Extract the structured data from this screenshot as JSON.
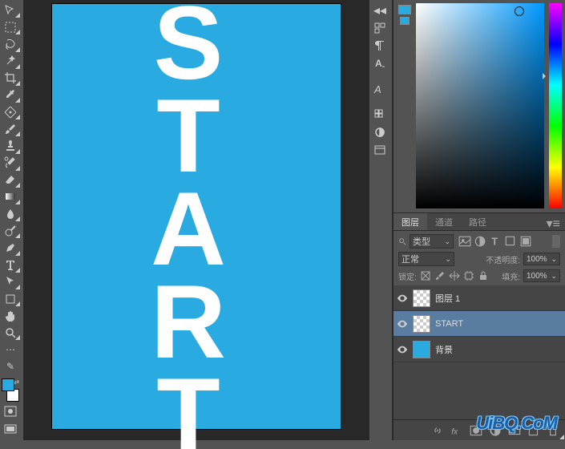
{
  "canvas": {
    "text": "START",
    "bg_color": "#29abe2",
    "text_color": "#ffffff"
  },
  "colors": {
    "foreground": "#29abe2",
    "background": "#ffffff"
  },
  "layers_panel": {
    "tabs": [
      "图层",
      "通道",
      "路径"
    ],
    "active_tab": 0,
    "filter_type": "类型",
    "blend_mode": "正常",
    "opacity_label": "不透明度:",
    "opacity_value": "100%",
    "lock_label": "锁定:",
    "fill_label": "填充:",
    "fill_value": "100%",
    "layers": [
      {
        "name": "图层 1",
        "visible": true,
        "thumb": "checker",
        "selected": false
      },
      {
        "name": "START",
        "visible": true,
        "thumb": "checker",
        "selected": true
      },
      {
        "name": "背景",
        "visible": true,
        "thumb": "blue",
        "selected": false
      }
    ]
  },
  "watermark": "UiBQ.CoM",
  "tools_left": [
    "move",
    "marquee",
    "lasso",
    "wand",
    "crop",
    "eyedropper",
    "patch",
    "brush",
    "stamp",
    "history-brush",
    "eraser",
    "gradient",
    "blur",
    "dodge",
    "pen",
    "type",
    "path-select",
    "rectangle",
    "hand",
    "zoom"
  ],
  "tools_mid": [
    "arrange",
    "char-panel",
    "paragraph",
    "glyphs",
    "swatches",
    "adjustments",
    "properties"
  ]
}
